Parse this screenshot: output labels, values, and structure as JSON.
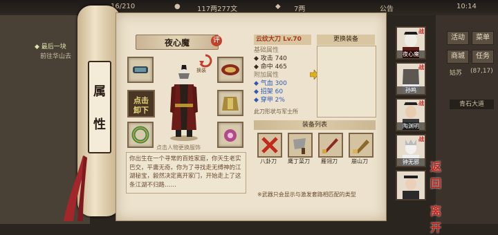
{
  "topbar": {
    "level": "16/210",
    "money": "117两277文",
    "silver": "7两",
    "notice": "公告",
    "time": "10:14"
  },
  "left_quest": {
    "title": "◆ 最后一块",
    "sub": "前往华山去"
  },
  "side_menu": [
    "活动",
    "菜单",
    "商城",
    "任务",
    "姑苏",
    "(87,17)"
  ],
  "side_location": "青石大道",
  "tab": {
    "chars": [
      "属",
      "性"
    ]
  },
  "character": {
    "name": "夜心魔",
    "rating": "评",
    "change_label": "换装",
    "hint": "点击人物更换服饰",
    "unequip_line1": "点击",
    "unequip_line2": "卸下",
    "description": "你出生在一个寻常的百姓家庭，你天生老实巴交，平庸无奇。你为了寻找走无缚神的江湖秘宝，毅然决定离开家门，开始走上了这条江湖不归路……"
  },
  "weapon": {
    "name_level": "云纹大刀 Lv.70",
    "base_title": "基础属性",
    "base_stats": [
      {
        "label": "◆ 攻击",
        "value": "740"
      },
      {
        "label": "◆ 命中",
        "value": "465"
      }
    ],
    "extra_title": "附加属性",
    "extra_stats": [
      {
        "label": "◆ 气血",
        "value": "300"
      },
      {
        "label": "◆ 招架",
        "value": "60"
      },
      {
        "label": "◆ 穿甲",
        "value": "2%"
      }
    ],
    "note": "此刀形状与军士所"
  },
  "replace": {
    "title": "更换装备"
  },
  "equip_list": {
    "title": "装备列表",
    "items": [
      "八卦刀",
      "鹰丁菜刀",
      "雁翎刀",
      "崩山刀"
    ],
    "bottom_note": "※武器只会显示与激发套路相匹配的类型"
  },
  "portraits": [
    {
      "name": "夜心魔",
      "battle": "战"
    },
    {
      "name": "孙鸣",
      "battle": "战"
    },
    {
      "name": "陶渊明",
      "battle": "战"
    },
    {
      "name": "钟无邪",
      "battle": "战"
    },
    {
      "name": "",
      "battle": ""
    }
  ],
  "back": {
    "line1": "返回",
    "line2": "离开"
  },
  "colors": {
    "parchment": "#ece2cd",
    "accent_red": "#c1231a",
    "stat_blue": "#2d5ab8"
  }
}
